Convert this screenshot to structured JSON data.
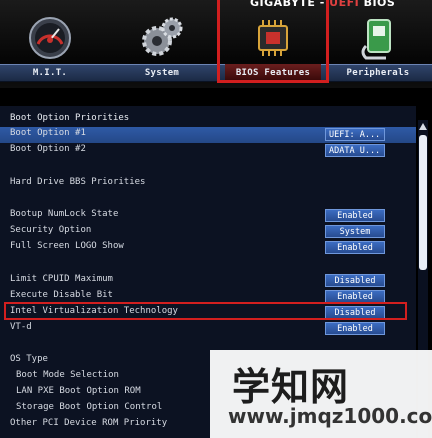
{
  "header": {
    "brand_gigabyte": "GIGABYTE",
    "brand_sep": " - ",
    "brand_uefi": "UEFI",
    "brand_bios": " BIOS",
    "tabs": [
      {
        "label": "M.I.T.",
        "icon": "speedometer-icon"
      },
      {
        "label": "System",
        "icon": "gears-icon"
      },
      {
        "label": "BIOS Features",
        "icon": "chip-icon",
        "selected": true
      },
      {
        "label": "Peripherals",
        "icon": "plug-icon"
      }
    ]
  },
  "settings": {
    "boot_priorities_title": "Boot Option Priorities",
    "boot_option_1": {
      "label": "Boot Option #1",
      "value": "UEFI: A..."
    },
    "boot_option_2": {
      "label": "Boot Option #2",
      "value": "ADATA U..."
    },
    "hdd_bbs": "Hard Drive BBS Priorities",
    "bootup_numlock": {
      "label": "Bootup NumLock State",
      "value": "Enabled"
    },
    "security_option": {
      "label": "Security Option",
      "value": "System"
    },
    "full_screen_logo": {
      "label": "Full Screen LOGO Show",
      "value": "Enabled"
    },
    "limit_cpuid": {
      "label": "Limit CPUID Maximum",
      "value": "Disabled"
    },
    "execute_disable": {
      "label": "Execute Disable Bit",
      "value": "Enabled"
    },
    "intel_vt": {
      "label": "Intel Virtualization Technology",
      "value": "Disabled"
    },
    "vtd": {
      "label": "VT-d",
      "value": "Enabled"
    },
    "os_type": "OS Type",
    "boot_mode_selection": "Boot Mode Selection",
    "lan_pxe": "LAN PXE Boot Option ROM",
    "storage_boot": "Storage Boot Option Control",
    "other_pci": "Other PCI Device ROM Priority"
  },
  "watermark": {
    "chinese": "学知网",
    "url": "www.jmqz1000.com"
  },
  "colors": {
    "highlight_box": "#d21f1f",
    "value_button": "#3c6cc2",
    "panel_bg": "#0c1222"
  }
}
